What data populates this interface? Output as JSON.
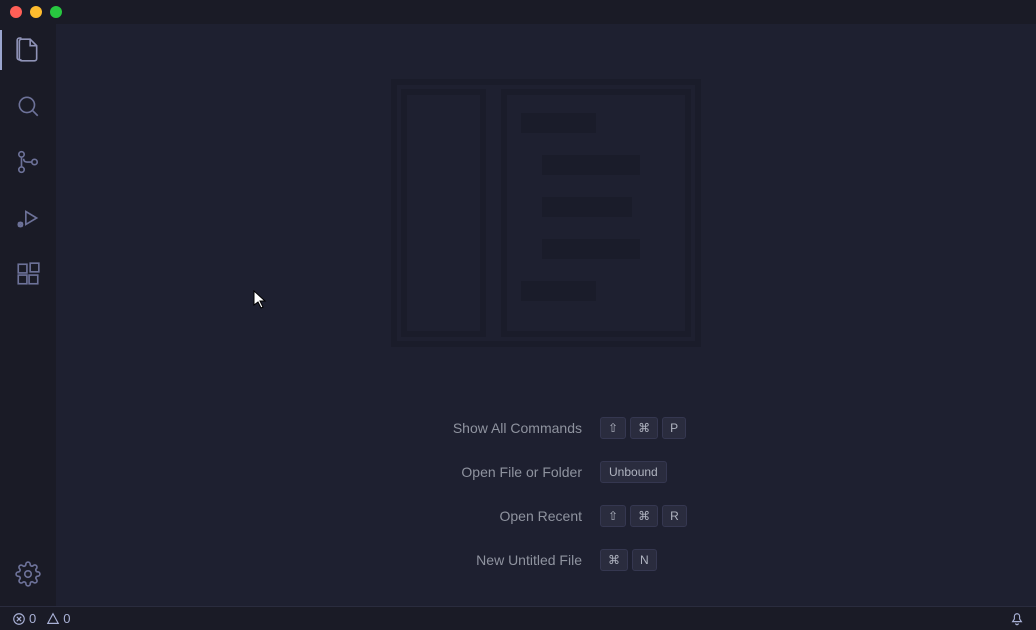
{
  "activity_bar": {
    "items": [
      {
        "name": "explorer",
        "active": true
      },
      {
        "name": "search",
        "active": false
      },
      {
        "name": "source-control",
        "active": false
      },
      {
        "name": "run-debug",
        "active": false
      },
      {
        "name": "extensions",
        "active": false
      }
    ],
    "bottom": {
      "name": "settings"
    }
  },
  "watermark": {
    "shortcuts": [
      {
        "label": "Show All Commands",
        "keys": [
          "⇧",
          "⌘",
          "P"
        ]
      },
      {
        "label": "Open File or Folder",
        "keys": [
          "Unbound"
        ]
      },
      {
        "label": "Open Recent",
        "keys": [
          "⇧",
          "⌘",
          "R"
        ]
      },
      {
        "label": "New Untitled File",
        "keys": [
          "⌘",
          "N"
        ]
      }
    ]
  },
  "status_bar": {
    "errors": "0",
    "warnings": "0"
  }
}
